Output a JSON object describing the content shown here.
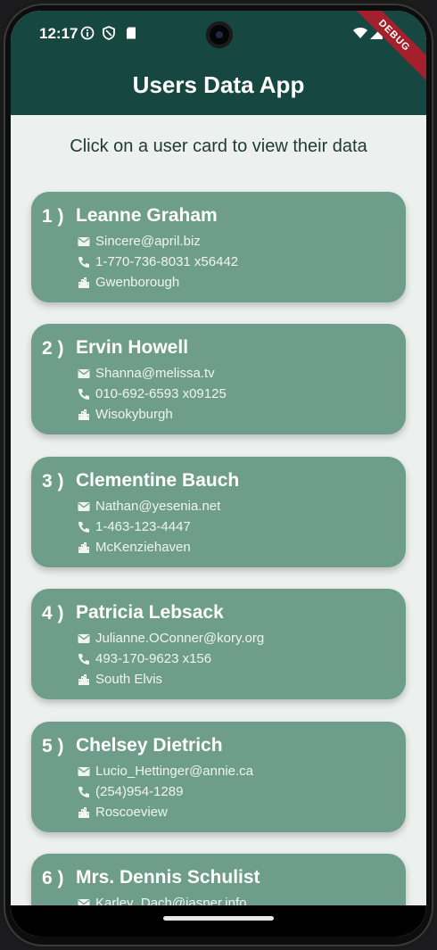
{
  "status": {
    "time": "12:17",
    "debug_label": "DEBUG"
  },
  "app": {
    "title": "Users Data App",
    "subtitle": "Click on a user card to view their data"
  },
  "users": [
    {
      "index": "1 )",
      "name": "Leanne Graham",
      "email": "Sincere@april.biz",
      "phone": "1-770-736-8031 x56442",
      "city": "Gwenborough"
    },
    {
      "index": "2 )",
      "name": "Ervin Howell",
      "email": "Shanna@melissa.tv",
      "phone": "010-692-6593 x09125",
      "city": "Wisokyburgh"
    },
    {
      "index": "3 )",
      "name": "Clementine Bauch",
      "email": "Nathan@yesenia.net",
      "phone": "1-463-123-4447",
      "city": "McKenziehaven"
    },
    {
      "index": "4 )",
      "name": "Patricia Lebsack",
      "email": "Julianne.OConner@kory.org",
      "phone": "493-170-9623 x156",
      "city": "South Elvis"
    },
    {
      "index": "5 )",
      "name": "Chelsey Dietrich",
      "email": "Lucio_Hettinger@annie.ca",
      "phone": "(254)954-1289",
      "city": "Roscoeview"
    },
    {
      "index": "6 )",
      "name": "Mrs. Dennis Schulist",
      "email": "Karley_Dach@jasper.info",
      "phone": "",
      "city": ""
    }
  ],
  "icons": {
    "email": "email-icon",
    "phone": "phone-icon",
    "city": "city-icon"
  },
  "colors": {
    "appbar": "#164741",
    "card": "#6e9d8a",
    "background": "#ecf1ef",
    "debug_ribbon": "#a3212c"
  }
}
